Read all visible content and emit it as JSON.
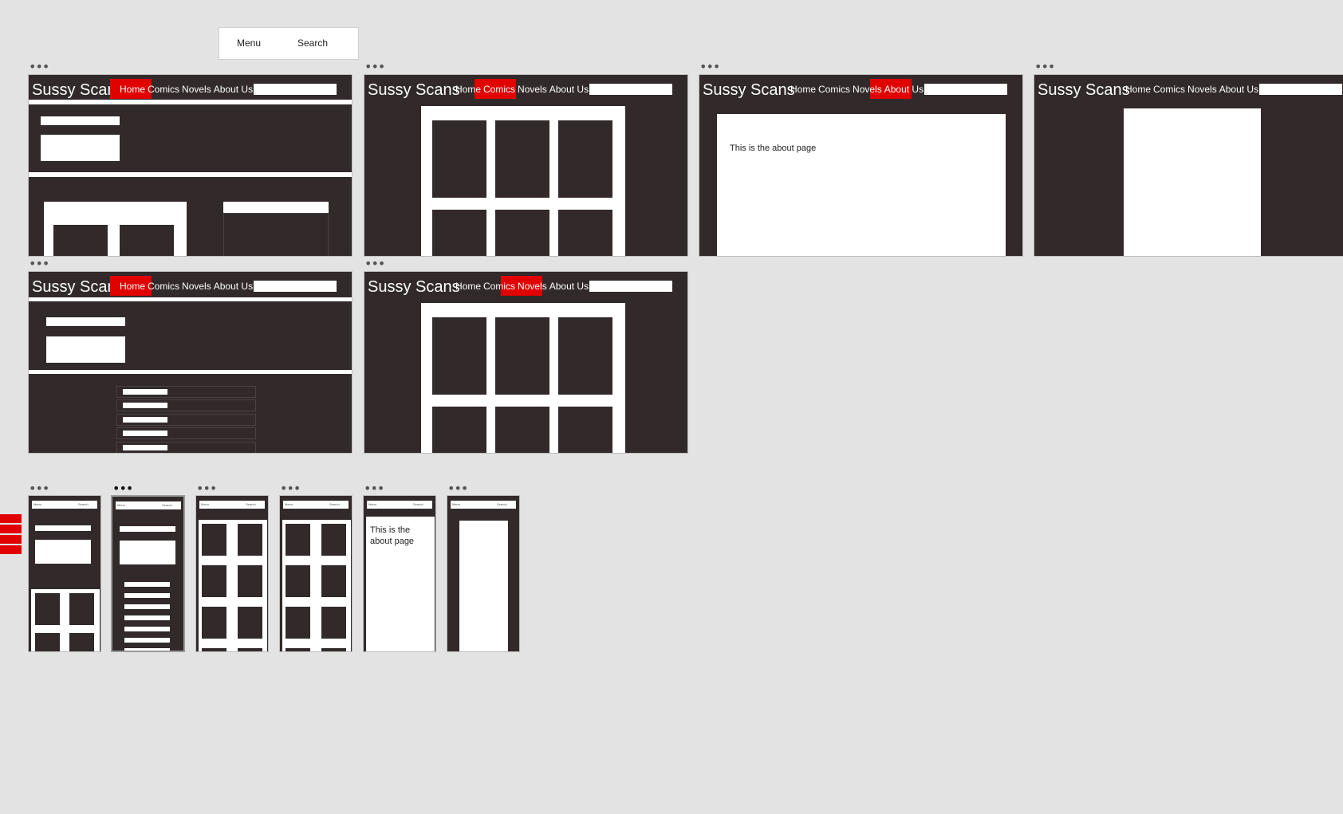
{
  "toolbar": {
    "menu_label": "Menu",
    "search_label": "Search"
  },
  "site": {
    "logo": "Sussy Scans",
    "nav": [
      "Home",
      "Comics",
      "Novels",
      "About Us"
    ],
    "about_text": "This is the about page",
    "mobile_about_text_line1": "This is the",
    "mobile_about_text_line2": "about page",
    "mobile_menu": "Menu",
    "mobile_search": "Search"
  },
  "artboards": {
    "desktop": [
      {
        "name": "home",
        "active_nav": "Home"
      },
      {
        "name": "comics",
        "active_nav": "Comics"
      },
      {
        "name": "about",
        "active_nav": "About Us"
      },
      {
        "name": "reader",
        "active_nav": ""
      },
      {
        "name": "novel-detail",
        "active_nav": "Home"
      },
      {
        "name": "novels",
        "active_nav": "Novels"
      }
    ],
    "mobile": [
      "home",
      "novel-detail",
      "comics",
      "novels",
      "about",
      "reader"
    ]
  },
  "colors": {
    "canvas": "#e3e3e3",
    "artboard": "#322a2a",
    "accent": "#e00000",
    "panel": "#ffffff"
  },
  "icons": {
    "artboard_options": "more-horizontal-icon"
  }
}
